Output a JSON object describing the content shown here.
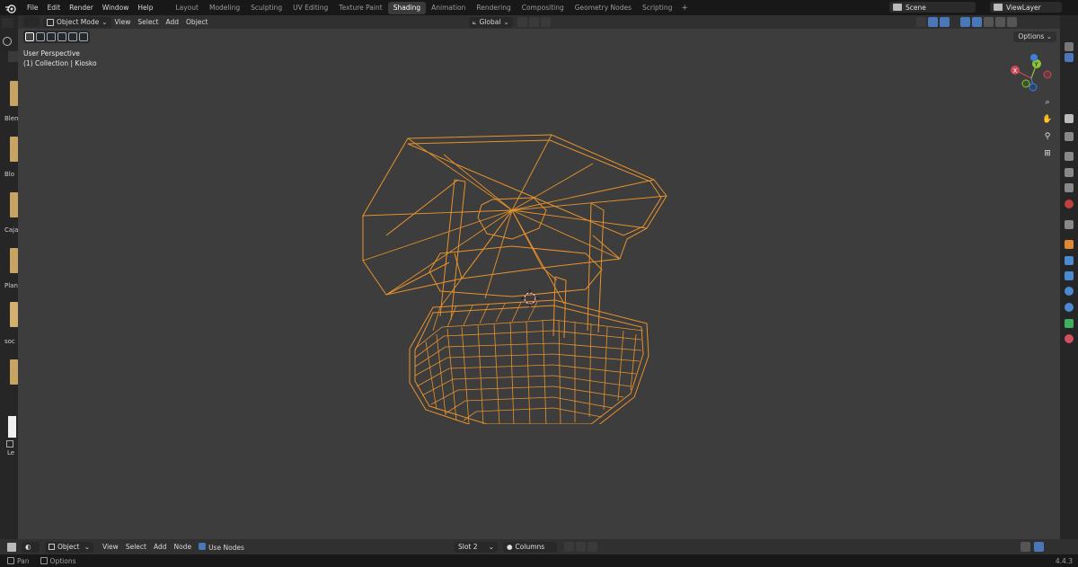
{
  "menu": [
    "File",
    "Edit",
    "Render",
    "Window",
    "Help"
  ],
  "workspaces": [
    "Layout",
    "Modeling",
    "Sculpting",
    "UV Editing",
    "Texture Paint",
    "Shading",
    "Animation",
    "Rendering",
    "Compositing",
    "Geometry Nodes",
    "Scripting"
  ],
  "active_workspace": "Shading",
  "scene": {
    "name": "Scene",
    "view_layer": "ViewLayer"
  },
  "viewport": {
    "mode": "Object Mode",
    "menus": [
      "View",
      "Select",
      "Add",
      "Object"
    ],
    "transform_orientation": "Global",
    "options_label": "Options",
    "view_name": "User Perspective",
    "collection_info": "(1) Collection | Kiosko",
    "gizmo_axes": {
      "x": "X",
      "y": "Y"
    }
  },
  "left_thumbnails": [
    "Blen",
    "Blo",
    "Caja",
    "Plan",
    "soc",
    "",
    "Le"
  ],
  "node_header": {
    "object_dropdown": "Object",
    "menus": [
      "View",
      "Select",
      "Add",
      "Node"
    ],
    "use_nodes_label": "Use Nodes",
    "slot": "Slot 2",
    "material": "Columns"
  },
  "status": {
    "left": "Pan",
    "middle": "Options",
    "version": "4.4.3"
  },
  "colors": {
    "wire": "#e8922c",
    "viewport_bg": "#3d3d3d",
    "accent": "#4a77b8"
  }
}
